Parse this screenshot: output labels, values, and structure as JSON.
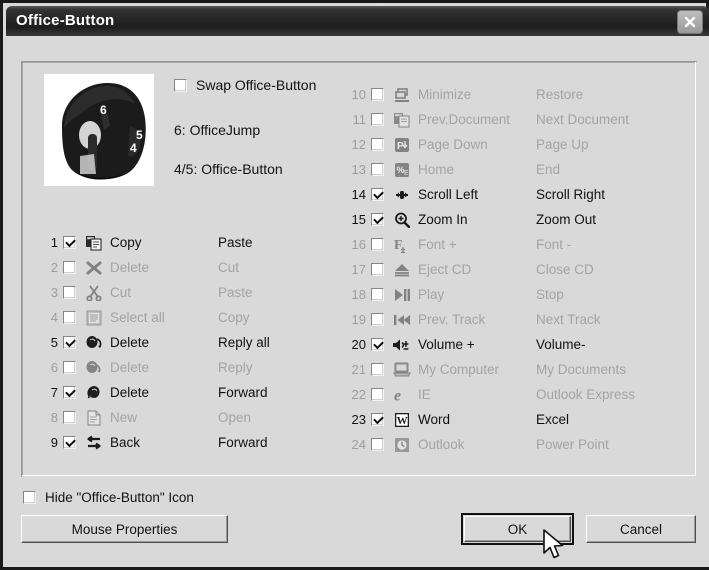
{
  "window": {
    "title": "Office-Button",
    "close_icon": "close-x-icon"
  },
  "mouse_panel": {
    "photo_alt": "black-wireless-mouse-photo",
    "photo_labels": [
      "6",
      "5",
      "4"
    ],
    "swap_checkbox": {
      "label": "Swap Office-Button",
      "checked": false
    },
    "info_line_1": "6: OfficeJump",
    "info_line_2": "4/5: Office-Button"
  },
  "assignments_left": [
    {
      "num": "1",
      "checked": true,
      "icon": "copy-icon",
      "label_a": "Copy",
      "label_b": "Paste"
    },
    {
      "num": "2",
      "checked": false,
      "icon": "delete-x-icon",
      "label_a": "Delete",
      "label_b": "Cut"
    },
    {
      "num": "3",
      "checked": false,
      "icon": "scissors-icon",
      "label_a": "Cut",
      "label_b": "Paste"
    },
    {
      "num": "4",
      "checked": false,
      "icon": "select-all-icon",
      "label_a": "Select all",
      "label_b": "Copy"
    },
    {
      "num": "5",
      "checked": true,
      "icon": "mail-reply-all-icon",
      "label_a": "Delete",
      "label_b": "Reply all"
    },
    {
      "num": "6",
      "checked": false,
      "icon": "mail-reply-icon",
      "label_a": "Delete",
      "label_b": "Reply"
    },
    {
      "num": "7",
      "checked": true,
      "icon": "mail-forward-icon",
      "label_a": "Delete",
      "label_b": "Forward"
    },
    {
      "num": "8",
      "checked": false,
      "icon": "new-document-icon",
      "label_a": "New",
      "label_b": "Open"
    },
    {
      "num": "9",
      "checked": true,
      "icon": "back-forward-arrows-icon",
      "label_a": "Back",
      "label_b": "Forward"
    }
  ],
  "assignments_right": [
    {
      "num": "10",
      "checked": false,
      "icon": "minimize-window-icon",
      "label_a": "Minimize",
      "label_b": "Restore"
    },
    {
      "num": "11",
      "checked": false,
      "icon": "prev-document-icon",
      "label_a": "Prev.Document",
      "label_b": "Next Document"
    },
    {
      "num": "12",
      "checked": false,
      "icon": "page-down-icon",
      "label_a": "Page Down",
      "label_b": "Page Up"
    },
    {
      "num": "13",
      "checked": false,
      "icon": "home-key-icon",
      "label_a": "Home",
      "label_b": "End"
    },
    {
      "num": "14",
      "checked": true,
      "icon": "scroll-left-icon",
      "label_a": "Scroll Left",
      "label_b": "Scroll Right"
    },
    {
      "num": "15",
      "checked": true,
      "icon": "zoom-in-icon",
      "label_a": "Zoom In",
      "label_b": "Zoom Out"
    },
    {
      "num": "16",
      "checked": false,
      "icon": "font-increase-icon",
      "label_a": "Font +",
      "label_b": "Font -"
    },
    {
      "num": "17",
      "checked": false,
      "icon": "eject-cd-icon",
      "label_a": "Eject CD",
      "label_b": "Close CD"
    },
    {
      "num": "18",
      "checked": false,
      "icon": "play-pause-icon",
      "label_a": "Play",
      "label_b": "Stop"
    },
    {
      "num": "19",
      "checked": false,
      "icon": "prev-track-icon",
      "label_a": "Prev. Track",
      "label_b": "Next Track"
    },
    {
      "num": "20",
      "checked": true,
      "icon": "volume-up-icon",
      "label_a": "Volume +",
      "label_b": "Volume-"
    },
    {
      "num": "21",
      "checked": false,
      "icon": "my-computer-icon",
      "label_a": "My Computer",
      "label_b": "My Documents"
    },
    {
      "num": "22",
      "checked": false,
      "icon": "internet-explorer-icon",
      "label_a": "IE",
      "label_b": "Outlook Express"
    },
    {
      "num": "23",
      "checked": true,
      "icon": "word-icon",
      "label_a": "Word",
      "label_b": "Excel"
    },
    {
      "num": "24",
      "checked": false,
      "icon": "outlook-icon",
      "label_a": "Outlook",
      "label_b": "Power Point"
    }
  ],
  "footer": {
    "hide_checkbox": {
      "label": "Hide \"Office-Button\" Icon",
      "checked": false
    },
    "mouse_properties_button": "Mouse Properties",
    "ok_button": "OK",
    "cancel_button": "Cancel",
    "cursor": "mouse-pointer-cursor"
  },
  "colors": {
    "dialog_bg": "#d9d9d9",
    "titlebar": "#262626",
    "title_text": "#ffffff",
    "text": "#111111",
    "text_disabled": "#a3a3a3"
  }
}
